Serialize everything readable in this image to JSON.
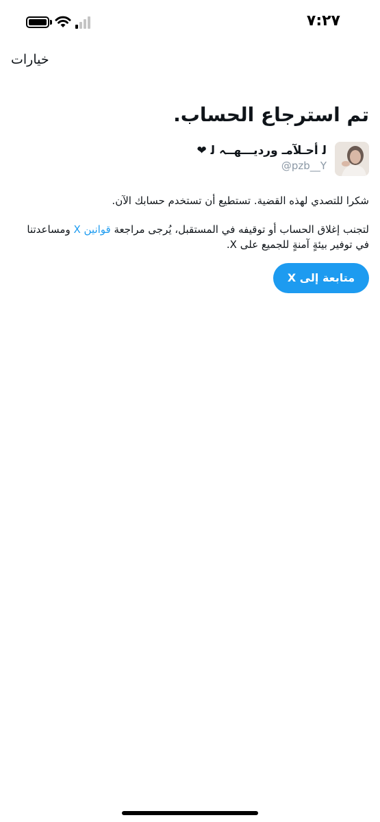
{
  "status_bar": {
    "time": "٧:٢٧"
  },
  "header": {
    "options_label": "خيارات"
  },
  "main": {
    "title": "تم استرجاع الحساب.",
    "profile": {
      "name": "ﻟ أحـلآمـ ورديـــهــہ ﻟ ❤",
      "handle": "@pzb__Y"
    },
    "message_1": "شكرا للتصدي لهذه القضية. تستطيع أن تستخدم حسابك الآن.",
    "message_2_before": "لتجنب إغلاق الحساب أو توقيفه في المستقبل، يُرجى مراجعة ",
    "message_2_link": "قوانين X",
    "message_2_after": " ومساعدتنا في توفير بيئةٍ آمنةٍ للجميع على X.",
    "continue_label": "متابعة إلى X"
  },
  "colors": {
    "accent": "#1d9bf0",
    "text": "#0f1419",
    "muted": "#8b98a5"
  },
  "icons": [
    "battery-icon",
    "wifi-icon",
    "signal-icon"
  ]
}
